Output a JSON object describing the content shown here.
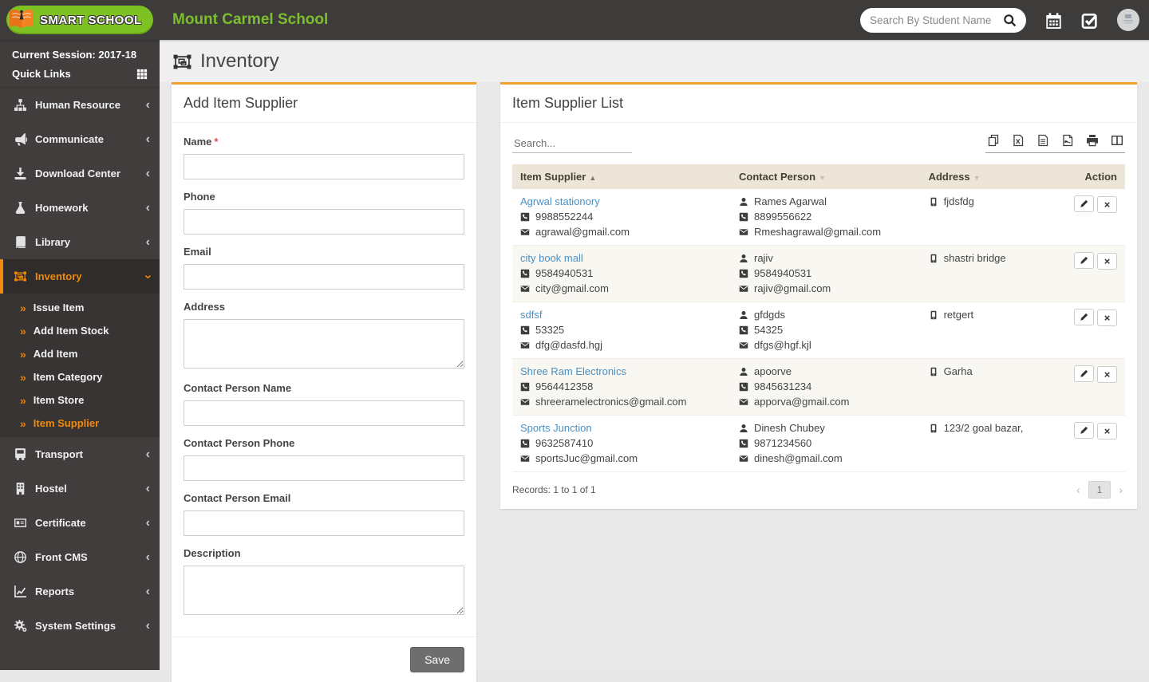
{
  "navbar": {
    "logo_text": "SMART SCHOOL",
    "school_name": "Mount Carmel School",
    "search_placeholder": "Search By Student Name"
  },
  "sidebar": {
    "session_label": "Current Session: 2017-18",
    "quick_links_label": "Quick Links",
    "items": [
      {
        "label": "Human Resource",
        "icon": "sitemap-icon"
      },
      {
        "label": "Communicate",
        "icon": "megaphone-icon"
      },
      {
        "label": "Download Center",
        "icon": "download-icon"
      },
      {
        "label": "Homework",
        "icon": "flask-icon"
      },
      {
        "label": "Library",
        "icon": "book-icon"
      },
      {
        "label": "Inventory",
        "icon": "object-group-icon",
        "active": true
      },
      {
        "label": "Transport",
        "icon": "bus-icon"
      },
      {
        "label": "Hostel",
        "icon": "building-icon"
      },
      {
        "label": "Certificate",
        "icon": "id-card-icon"
      },
      {
        "label": "Front CMS",
        "icon": "globe-icon"
      },
      {
        "label": "Reports",
        "icon": "chart-icon"
      },
      {
        "label": "System Settings",
        "icon": "gears-icon"
      }
    ],
    "inventory_submenu": [
      "Issue Item",
      "Add Item Stock",
      "Add Item",
      "Item Category",
      "Item Store",
      "Item Supplier"
    ],
    "active_submenu": "Item Supplier"
  },
  "page": {
    "title": "Inventory"
  },
  "form": {
    "title": "Add Item Supplier",
    "save_label": "Save",
    "fields": [
      {
        "label": "Name",
        "required": true,
        "type": "text"
      },
      {
        "label": "Phone",
        "type": "text"
      },
      {
        "label": "Email",
        "type": "text"
      },
      {
        "label": "Address",
        "type": "textarea"
      },
      {
        "label": "Contact Person Name",
        "type": "text"
      },
      {
        "label": "Contact Person Phone",
        "type": "text"
      },
      {
        "label": "Contact Person Email",
        "type": "text"
      },
      {
        "label": "Description",
        "type": "textarea"
      }
    ]
  },
  "list": {
    "title": "Item Supplier List",
    "search_placeholder": "Search...",
    "export_buttons": [
      "copy-icon",
      "excel-icon",
      "csv-icon",
      "pdf-icon",
      "print-icon",
      "columns-icon"
    ],
    "columns": [
      {
        "label": "Item Supplier",
        "sort": "asc"
      },
      {
        "label": "Contact Person",
        "sort": "desc"
      },
      {
        "label": "Address",
        "sort": "desc"
      },
      {
        "label": "Action",
        "sort": null
      }
    ],
    "rows": [
      {
        "supplier": "Agrwal stationory",
        "phone": "9988552244",
        "email": "agrawal@gmail.com",
        "contact_name": "Rames Agarwal",
        "contact_phone": "8899556622",
        "contact_email": "Rmeshagrawal@gmail.com",
        "address": "fjdsfdg"
      },
      {
        "supplier": "city book mall",
        "phone": "9584940531",
        "email": "city@gmail.com",
        "contact_name": "rajiv",
        "contact_phone": "9584940531",
        "contact_email": "rajiv@gmail.com",
        "address": "shastri bridge"
      },
      {
        "supplier": "sdfsf",
        "phone": "53325",
        "email": "dfg@dasfd.hgj",
        "contact_name": "gfdgds",
        "contact_phone": "54325",
        "contact_email": "dfgs@hgf.kjl",
        "address": "retgert"
      },
      {
        "supplier": "Shree Ram Electronics",
        "phone": "9564412358",
        "email": "shreeramelectronics@gmail.com",
        "contact_name": "apoorve",
        "contact_phone": "9845631234",
        "contact_email": "apporva@gmail.com",
        "address": "Garha"
      },
      {
        "supplier": "Sports Junction",
        "phone": "9632587410",
        "email": "sportsJuc@gmail.com",
        "contact_name": "Dinesh Chubey",
        "contact_phone": "9871234560",
        "contact_email": "dinesh@gmail.com",
        "address": "123/2 goal bazar,"
      }
    ],
    "records_text": "Records: 1 to 1 of 1",
    "pagination": {
      "prev": "‹",
      "page": "1",
      "next": "›"
    }
  },
  "colors": {
    "navbar_dark": "#3E3C3B",
    "sidebar_dark": "#403D3C",
    "accent_orange": "#EF8A0D",
    "card_top_orange": "#F0A02F",
    "brand_green": "#7DBE2E",
    "logo_green": "#7DC122",
    "link_blue": "#4A90C4",
    "table_header_beige": "#ECE5D8",
    "row_alt_beige": "#F9F7F1",
    "required_red": "#D9534F"
  }
}
